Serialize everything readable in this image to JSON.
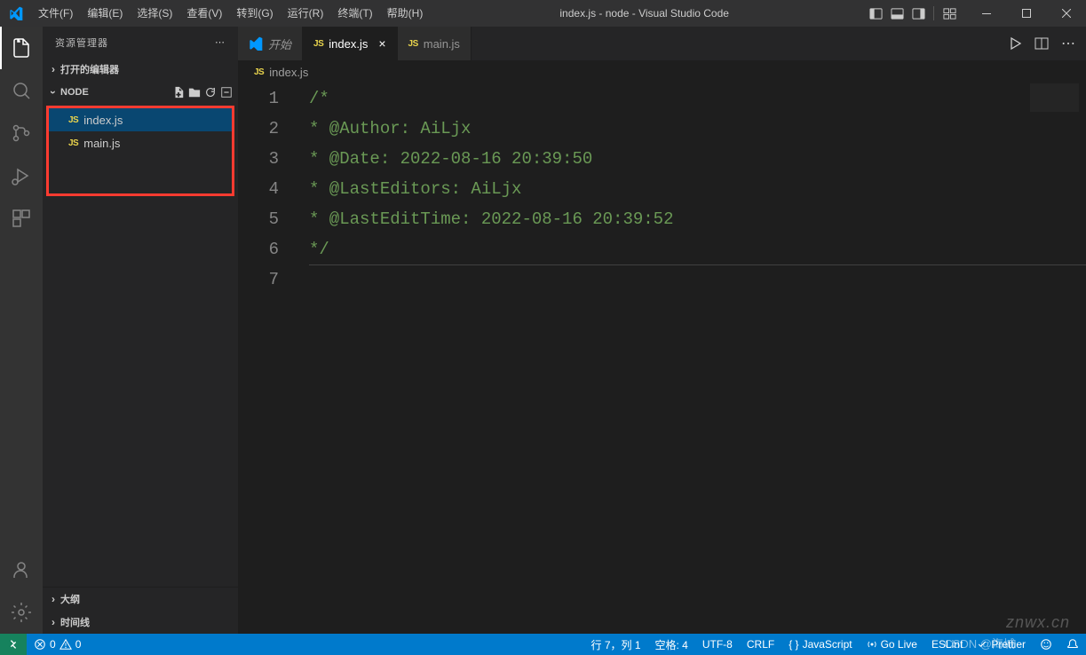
{
  "titlebar": {
    "menus": [
      "文件(F)",
      "编辑(E)",
      "选择(S)",
      "查看(V)",
      "转到(G)",
      "运行(R)",
      "终端(T)",
      "帮助(H)"
    ],
    "title": "index.js - node - Visual Studio Code"
  },
  "sidebar": {
    "title": "资源管理器",
    "open_editors": "打开的编辑器",
    "folder": "NODE",
    "files": [
      "index.js",
      "main.js"
    ],
    "outline": "大纲",
    "timeline": "时间线"
  },
  "tabs": [
    {
      "label": "开始",
      "type": "welcome"
    },
    {
      "label": "index.js",
      "type": "js",
      "active": true
    },
    {
      "label": "main.js",
      "type": "js"
    }
  ],
  "breadcrumb": {
    "file": "index.js"
  },
  "code": {
    "lines": [
      "/*",
      " * @Author: AiLjx",
      " * @Date: 2022-08-16 20:39:50",
      " * @LastEditors: AiLjx",
      " * @LastEditTime: 2022-08-16 20:39:52",
      " */",
      ""
    ]
  },
  "statusbar": {
    "errors": "0",
    "warnings": "0",
    "cursor": "行 7，列 1",
    "spaces": "空格: 4",
    "encoding": "UTF-8",
    "eol": "CRLF",
    "language": "JavaScript",
    "golive": "Go Live",
    "eslint": "ESLint",
    "prettier": "Prettier"
  },
  "watermark": "znwx.cn",
  "watermark2": "CSDN @海城"
}
